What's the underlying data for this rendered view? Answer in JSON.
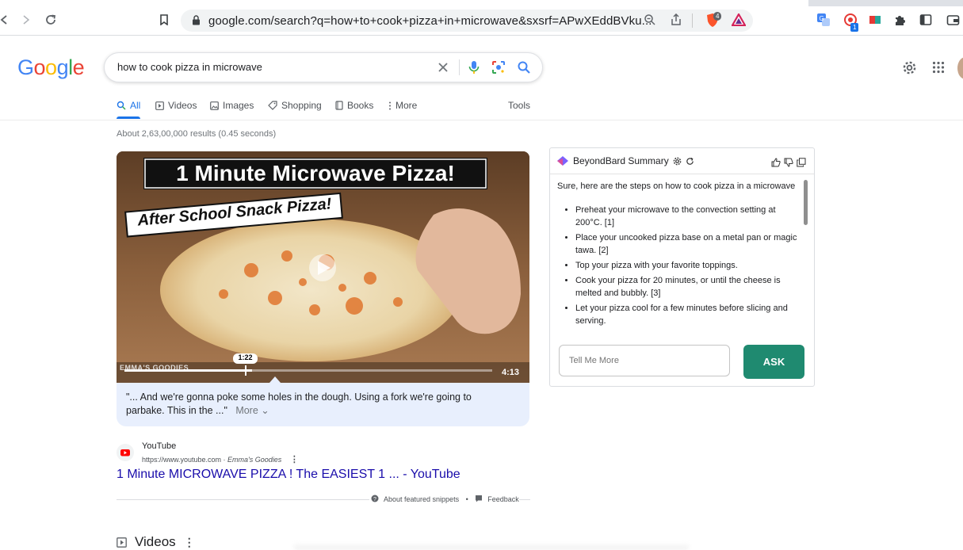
{
  "browser": {
    "url": "google.com/search?q=how+to+cook+pizza+in+microwave&sxsrf=APwXEddBVku...",
    "brave_badge": "4",
    "ext_badge": "1"
  },
  "google": {
    "logo": "Google",
    "query": "how to cook pizza in microwave",
    "tabs": [
      {
        "label": "All"
      },
      {
        "label": "Videos"
      },
      {
        "label": "Images"
      },
      {
        "label": "Shopping"
      },
      {
        "label": "Books"
      },
      {
        "label": "More"
      }
    ],
    "tools": "Tools",
    "stats": "About 2,63,00,000 results (0.45 seconds)"
  },
  "video": {
    "title_main": "1 Minute Microwave Pizza!",
    "title_sub": "After School Snack Pizza!",
    "brand": "EMMA'S GOODIES",
    "current_time": "1:22",
    "duration": "4:13",
    "progress": 0.348,
    "snippet": "\"... And we're gonna poke some holes in the dough. Using a fork we're going to parbake. This in the ...\"",
    "more": "More"
  },
  "result": {
    "site_name": "YouTube",
    "site_url": "https://www.youtube.com",
    "site_author": "Emma's Goodies",
    "link_text": "1 Minute MICROWAVE PIZZA ! The EASIEST 1 ... - YouTube",
    "about": "About featured snippets",
    "feedback": "Feedback",
    "videos_heading": "Videos"
  },
  "bard": {
    "title": "BeyondBard Summary",
    "intro": "Sure, here are the steps on how to cook pizza in a microwave",
    "steps": [
      "Preheat your microwave to the convection setting at 200°C. [1]",
      "Place your uncooked pizza base on a metal pan or magic tawa. [2]",
      "Top your pizza with your favorite toppings.",
      "Cook your pizza for 20 minutes, or until the cheese is melted and bubbly. [3]",
      "Let your pizza cool for a few minutes before slicing and serving."
    ],
    "placeholder": "Tell Me More",
    "ask": "ASK"
  },
  "colors": {
    "accent": "#1a73e8",
    "link": "#1a0dab",
    "ask_button": "#1f8a70"
  }
}
